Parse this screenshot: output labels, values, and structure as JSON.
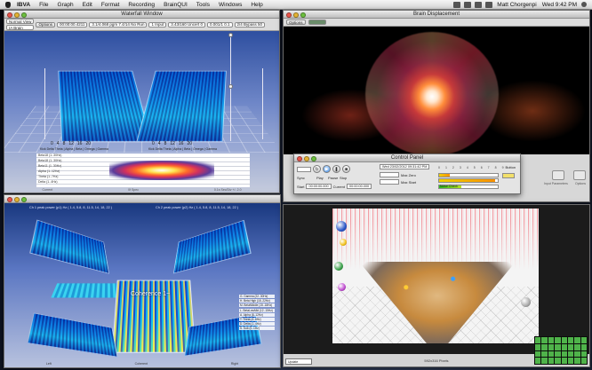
{
  "menubar": {
    "items": [
      "IBVA",
      "File",
      "Graph",
      "Edit",
      "Format",
      "Recording",
      "BrainQUI",
      "Tools",
      "Windows",
      "Help"
    ],
    "user": "Matt Chorgenpi",
    "clock": "Wed 9:42 PM"
  },
  "waterfall": {
    "title": "Waterfall Window",
    "toolbar": {
      "mode": "Normal View",
      "options": "Options",
      "file": "IA Brain",
      "time1": "00:00:00.4211",
      "peak": "3.1/4.068 pgm 7.4/14 No Run",
      "input": "1 Input",
      "output": "3.43/160 Uncert 0",
      "count": "0.001/1 0.1",
      "bypass": "2/4 Bypass 50"
    },
    "scale_ticks": [
      "0",
      "4",
      "8",
      "12",
      "16",
      "20",
      "0",
      "4",
      "8",
      "12",
      "16",
      "20"
    ],
    "axis_left": "Kick Delta Theta | Alpha | Beta | Omega | Gamma",
    "axis_right": "Kick Delta Theta | Alpha | Beta | Omega | Gamma",
    "bands": [
      "Beta18 (1..30Hz)",
      "Beta18 (1..30Hz)",
      "Beta11 (1..30Hz)",
      "Alpha (1..12Hz)",
      "Theta (1..7Hz)",
      "Delta (1..4Hz)"
    ],
    "footer": [
      "Current",
      "0f Spec",
      "0.1s  Sec/Div  +/- 2.0"
    ]
  },
  "brain": {
    "title": "Brain Displacement",
    "button": "Options",
    "tiles": [
      "Input Parameters",
      "Options"
    ]
  },
  "control": {
    "title": "Control Panel",
    "date": "Wed 23/02/2012 09:31:42 PM",
    "buttons": [
      "Sync",
      "Play",
      "Pause",
      "Stop"
    ],
    "start_label": "Start",
    "current_label": "Current",
    "start_time": "00:00:00.000",
    "current_time": "00:00:00.000",
    "max_zero": "Max Zero",
    "max_start": "Max Start",
    "ticks": [
      "0",
      "1",
      "2",
      "3",
      "4",
      "5",
      "6",
      "7",
      "8",
      "9"
    ],
    "button_label": "Button",
    "check_label": "Noise Check"
  },
  "coherence": {
    "header_left": "Ch 1 peak power (p1) Hz ( 1.4, 5.8, 8, 11.5, 14, 18, 22 )",
    "header_right": "Ch 2 peak power (p2) Hz ( 1.4, 5.8, 8, 11.5, 14, 18, 22 )",
    "center_title": "Coherence 1~",
    "legend": [
      "G. Gamma (22..30Hz)",
      "H. Beta High (18..22Hz)",
      "M. BetaMiddle (15..18Hz)",
      "L. BetaLowMid (12..15Hz)",
      "A. Alpha (8..12Hz)",
      "T. Theta (4..8Hz)",
      "D. Delta (1..4Hz)",
      "S. Sub (0..1Hz)"
    ],
    "bottom": [
      "Left",
      "Coherent",
      "Right"
    ]
  },
  "scatter": {
    "footer": "592x316 Pixels",
    "command": "Update"
  }
}
